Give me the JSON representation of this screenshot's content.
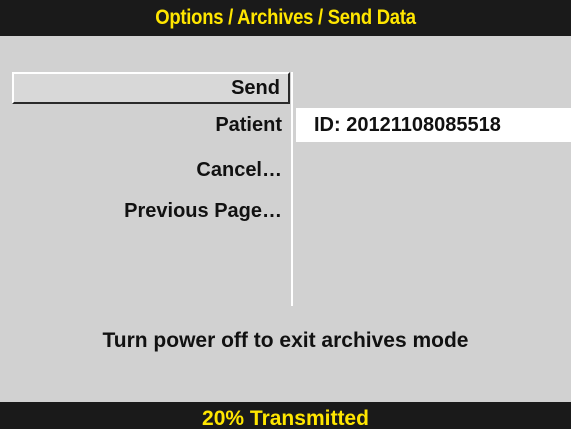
{
  "header": {
    "title": "Options / Archives / Send Data"
  },
  "menu": {
    "items": [
      {
        "label": "Send",
        "selected": true
      },
      {
        "label": "Patient",
        "selected": false
      },
      {
        "label": "Cancel…",
        "selected": false
      },
      {
        "label": "Previous Page…",
        "selected": false
      }
    ]
  },
  "detail": {
    "patient_id": "ID: 20121108085518"
  },
  "message": {
    "text": "Turn power off to exit archives mode"
  },
  "status": {
    "text": "20% Transmitted",
    "progress_percent": 20
  },
  "colors": {
    "background": "#d1d1d1",
    "bar_background": "#1a1a1a",
    "bar_text": "#ffe600",
    "highlight_panel": "#ffffff"
  }
}
